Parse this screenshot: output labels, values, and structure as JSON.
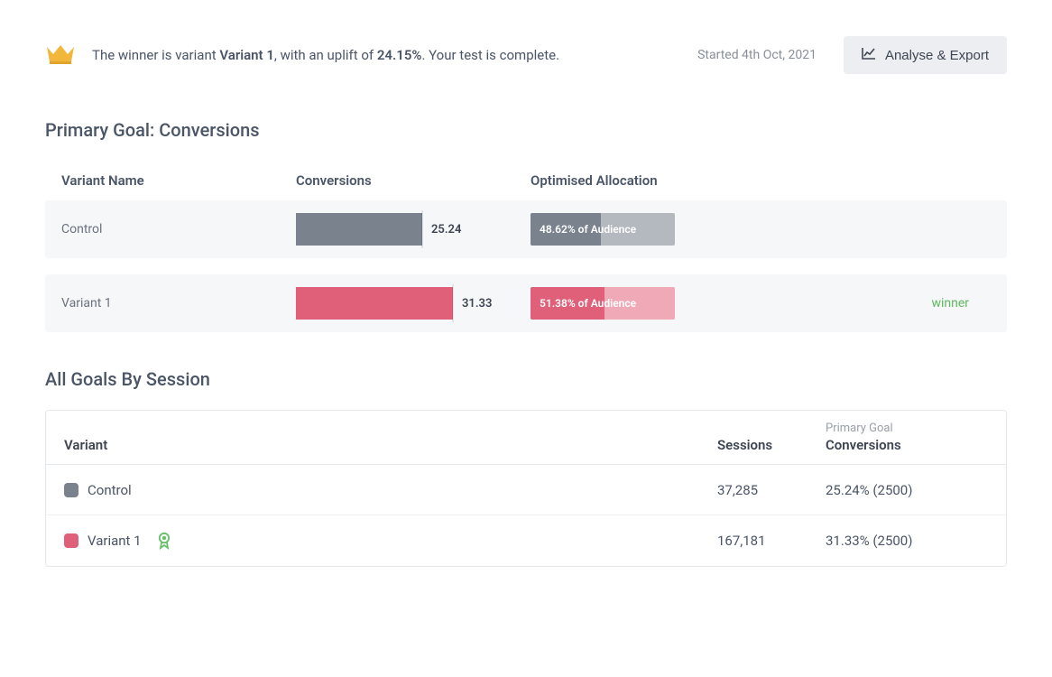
{
  "header": {
    "winner_prefix": "The winner is variant ",
    "winner_variant": "Variant 1",
    "winner_mid": ", with an uplift of ",
    "winner_uplift": "24.15%",
    "winner_suffix": ". Your test is complete.",
    "started": "Started 4th Oct, 2021",
    "analyse_label": "Analyse & Export"
  },
  "primary_goal": {
    "title": "Primary Goal: Conversions",
    "columns": {
      "name": "Variant Name",
      "conversions": "Conversions",
      "allocation": "Optimised Allocation"
    },
    "rows": [
      {
        "name": "Control",
        "conv_value": "25.24",
        "alloc_text": "48.62% of Audience",
        "winner": ""
      },
      {
        "name": "Variant 1",
        "conv_value": "31.33",
        "alloc_text": "51.38% of Audience",
        "winner": "winner"
      }
    ]
  },
  "all_goals": {
    "title": "All Goals By Session",
    "columns": {
      "variant": "Variant",
      "sessions": "Sessions",
      "pg_sup": "Primary Goal",
      "pg_main": "Conversions"
    },
    "rows": [
      {
        "name": "Control",
        "sessions": "37,285",
        "pg": "25.24% (2500)"
      },
      {
        "name": "Variant 1",
        "sessions": "167,181",
        "pg": "31.33% (2500)"
      }
    ]
  },
  "chart_data": [
    {
      "type": "bar",
      "title": "Primary Goal: Conversions",
      "categories": [
        "Control",
        "Variant 1"
      ],
      "series": [
        {
          "name": "Conversions",
          "values": [
            25.24,
            31.33
          ]
        }
      ],
      "ylabel": "Conversions"
    },
    {
      "type": "bar",
      "title": "Optimised Allocation (% of Audience)",
      "categories": [
        "Control",
        "Variant 1"
      ],
      "series": [
        {
          "name": "Allocation %",
          "values": [
            48.62,
            51.38
          ]
        }
      ],
      "ylim": [
        0,
        100
      ],
      "ylabel": "% of Audience"
    }
  ]
}
